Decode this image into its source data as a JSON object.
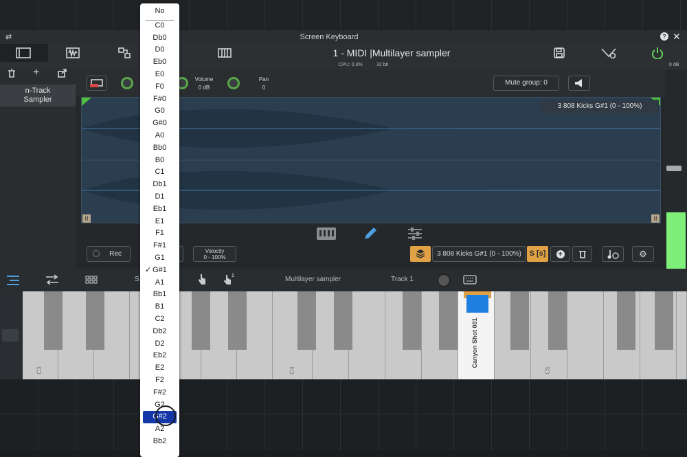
{
  "window": {
    "title": "Screen Keyboard",
    "track_title": "1 - MIDI |Multilayer sampler",
    "cpu": "CPU: 0.3%",
    "bits": "32 bit",
    "db_right": "0 dB"
  },
  "left_panel": {
    "sampler_name_line1": "n-Track",
    "sampler_name_line2": "Sampler"
  },
  "controls": {
    "volume_label": "Volume",
    "volume_value": "0 dB",
    "pan_label": "Pan",
    "pan_value": "0",
    "mute_group": "Mute group: 0"
  },
  "waveform": {
    "sample_label": "3 808 Kicks G#1 (0 - 100%)"
  },
  "layer_bar": {
    "rec_label": "Rec",
    "velocity_label": "Velocity",
    "velocity_value": "0 - 100%",
    "layer_name": "3 808 Kicks G#1 (0 - 100%)",
    "s_button": "S [s]"
  },
  "keyboard": {
    "instrument": "Multilayer sampler",
    "track": "Track 1",
    "partial_label": "S",
    "octave_labels": [
      "C3",
      "C4",
      "C5"
    ],
    "pressed_key_label": "Canyon Shot 001"
  },
  "dropdown": {
    "items": [
      "No",
      "C0",
      "Db0",
      "D0",
      "Eb0",
      "E0",
      "F0",
      "F#0",
      "G0",
      "G#0",
      "A0",
      "Bb0",
      "B0",
      "C1",
      "Db1",
      "D1",
      "Eb1",
      "E1",
      "F1",
      "F#1",
      "G1",
      "G#1",
      "A1",
      "Bb1",
      "B1",
      "C2",
      "Db2",
      "D2",
      "Eb2",
      "E2",
      "F2",
      "F#2",
      "G2",
      "G#2",
      "A2",
      "Bb2"
    ],
    "checked": "G#1",
    "highlighted": "G#2"
  },
  "colors": {
    "accent_green": "#5aa84a",
    "waveform_bg": "#2b3e50",
    "highlight_blue": "#1538a8",
    "orange": "#e0a244",
    "meter_green": "#7ef07a"
  }
}
